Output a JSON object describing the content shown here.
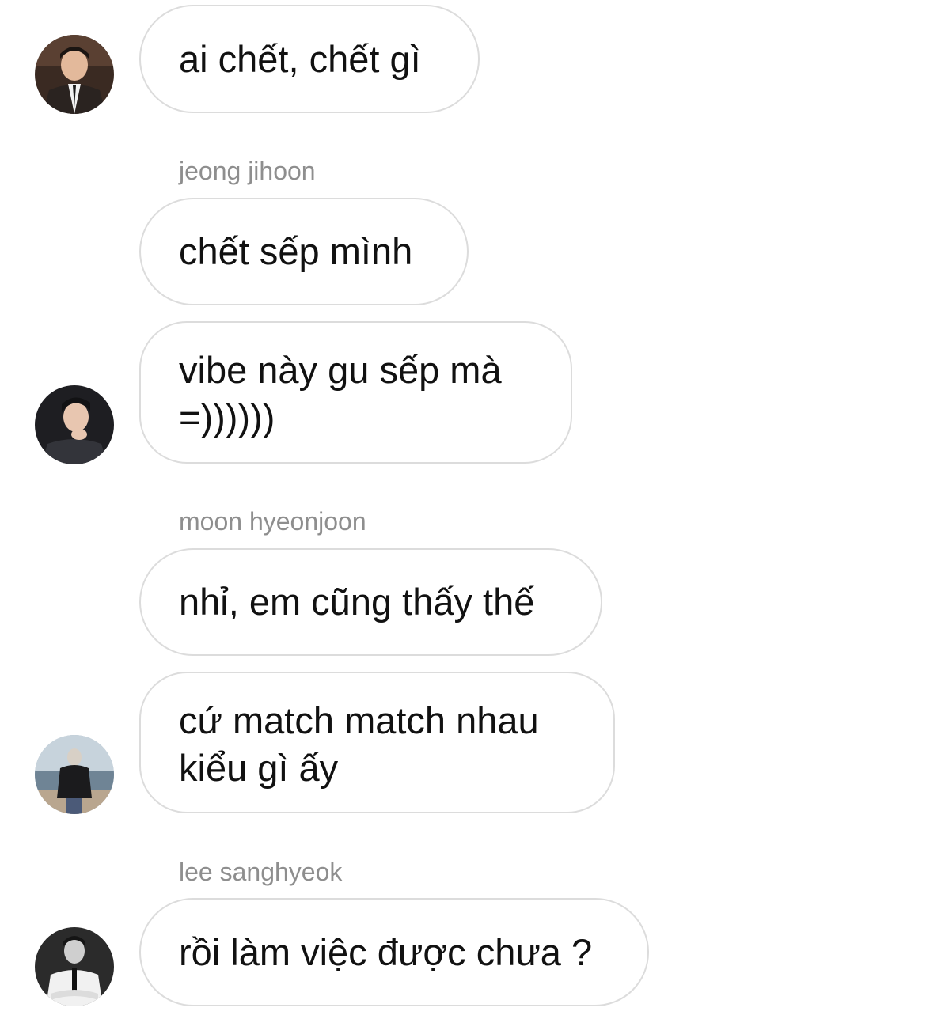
{
  "conversation": {
    "messages": [
      {
        "text": "ai chết, chết gì"
      },
      {
        "text": "chết sếp mình"
      },
      {
        "lines": [
          "vibe này gu sếp mà",
          "=))))))"
        ]
      },
      {
        "text": "nhỉ, em cũng thấy thế"
      },
      {
        "lines": [
          "cứ match match nhau",
          "kiểu gì ấy"
        ]
      },
      {
        "text": "rồi làm việc được chưa ?"
      }
    ],
    "senders": [
      "jeong jihoon",
      "moon hyeonjoon",
      "lee sanghyeok"
    ]
  }
}
